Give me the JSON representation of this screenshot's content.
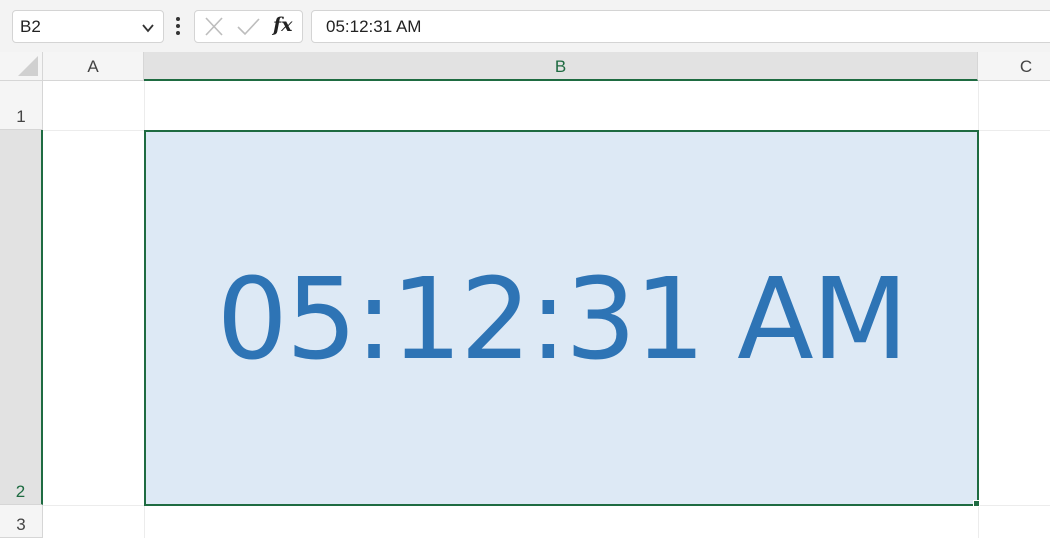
{
  "formula_bar": {
    "name_box": "B2",
    "cancel_icon": "close-icon",
    "enter_icon": "checkmark-icon",
    "function_label": "fx",
    "formula_value": "05:12:31 AM"
  },
  "columns": [
    {
      "label": "A",
      "selected": false
    },
    {
      "label": "B",
      "selected": true
    },
    {
      "label": "C",
      "selected": false
    }
  ],
  "rows": [
    {
      "label": "1",
      "selected": false
    },
    {
      "label": "2",
      "selected": true
    },
    {
      "label": "3",
      "selected": false
    }
  ],
  "cells": {
    "b2": {
      "display": "05:12:31 AM"
    }
  },
  "colors": {
    "selection_accent": "#1e6b41",
    "cell_fill": "#dde9f5",
    "cell_text": "#2e74b5"
  }
}
